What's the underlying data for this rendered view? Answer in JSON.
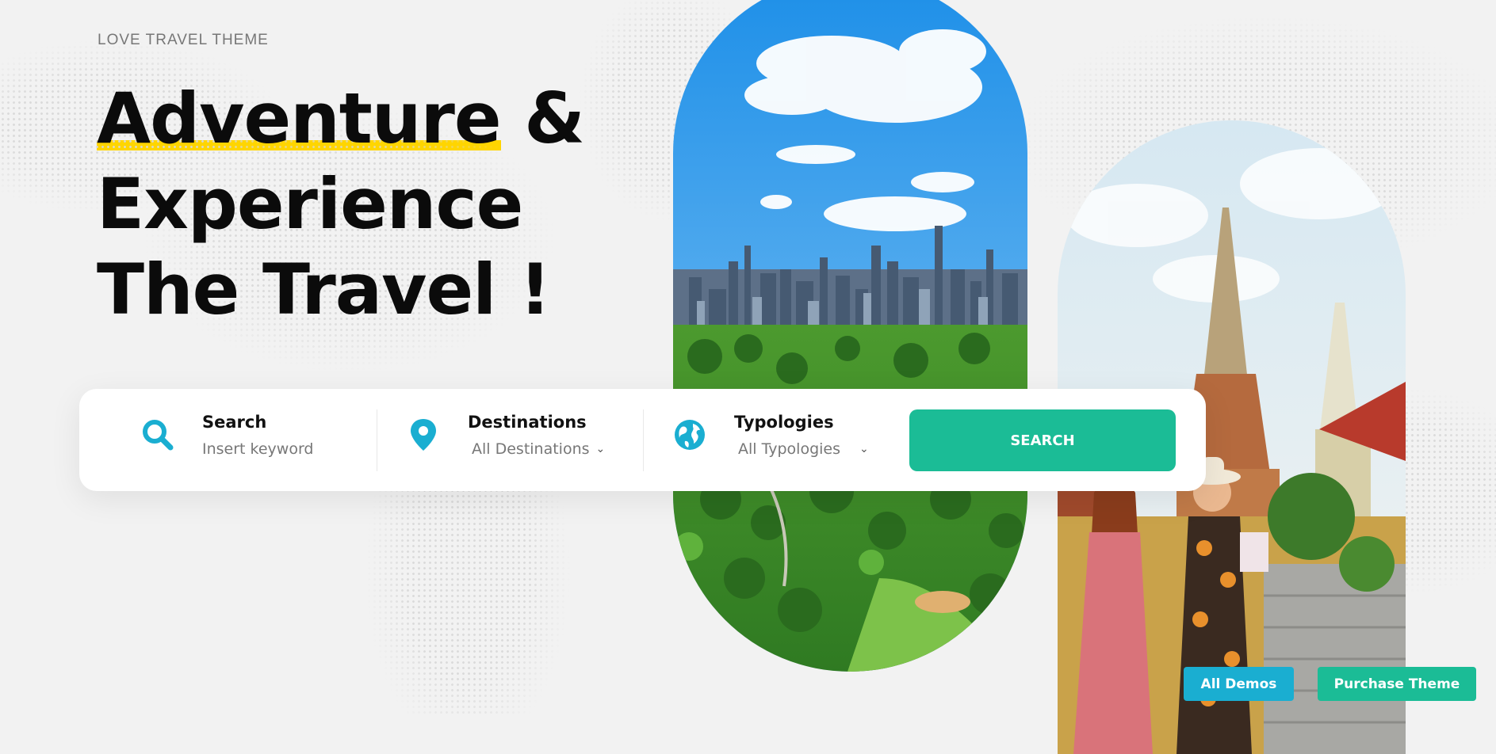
{
  "hero": {
    "eyebrow": "LOVE TRAVEL THEME",
    "headline": {
      "highlight": "Adventure",
      "line1_rest": " &",
      "line2": "Experience",
      "line3": "The Travel !"
    },
    "highlight_color": "#ffd500"
  },
  "search_bar": {
    "search": {
      "label": "Search",
      "placeholder": "Insert keyword",
      "icon": "search-icon"
    },
    "destinations": {
      "label": "Destinations",
      "selected": "All Destinations",
      "icon": "map-pin-icon"
    },
    "typologies": {
      "label": "Typologies",
      "selected": "All Typologies",
      "icon": "globe-icon"
    },
    "button_label": "SEARCH",
    "accent": "#1bbc96",
    "icon_color": "#1aaed1"
  },
  "images": {
    "left": "city-skyline-park-photo",
    "right": "temple-travelers-photo"
  },
  "corner_buttons": {
    "all_demos": "All Demos",
    "purchase_theme": "Purchase Theme",
    "demos_color": "#1aaed1",
    "purchase_color": "#1bbc96"
  }
}
